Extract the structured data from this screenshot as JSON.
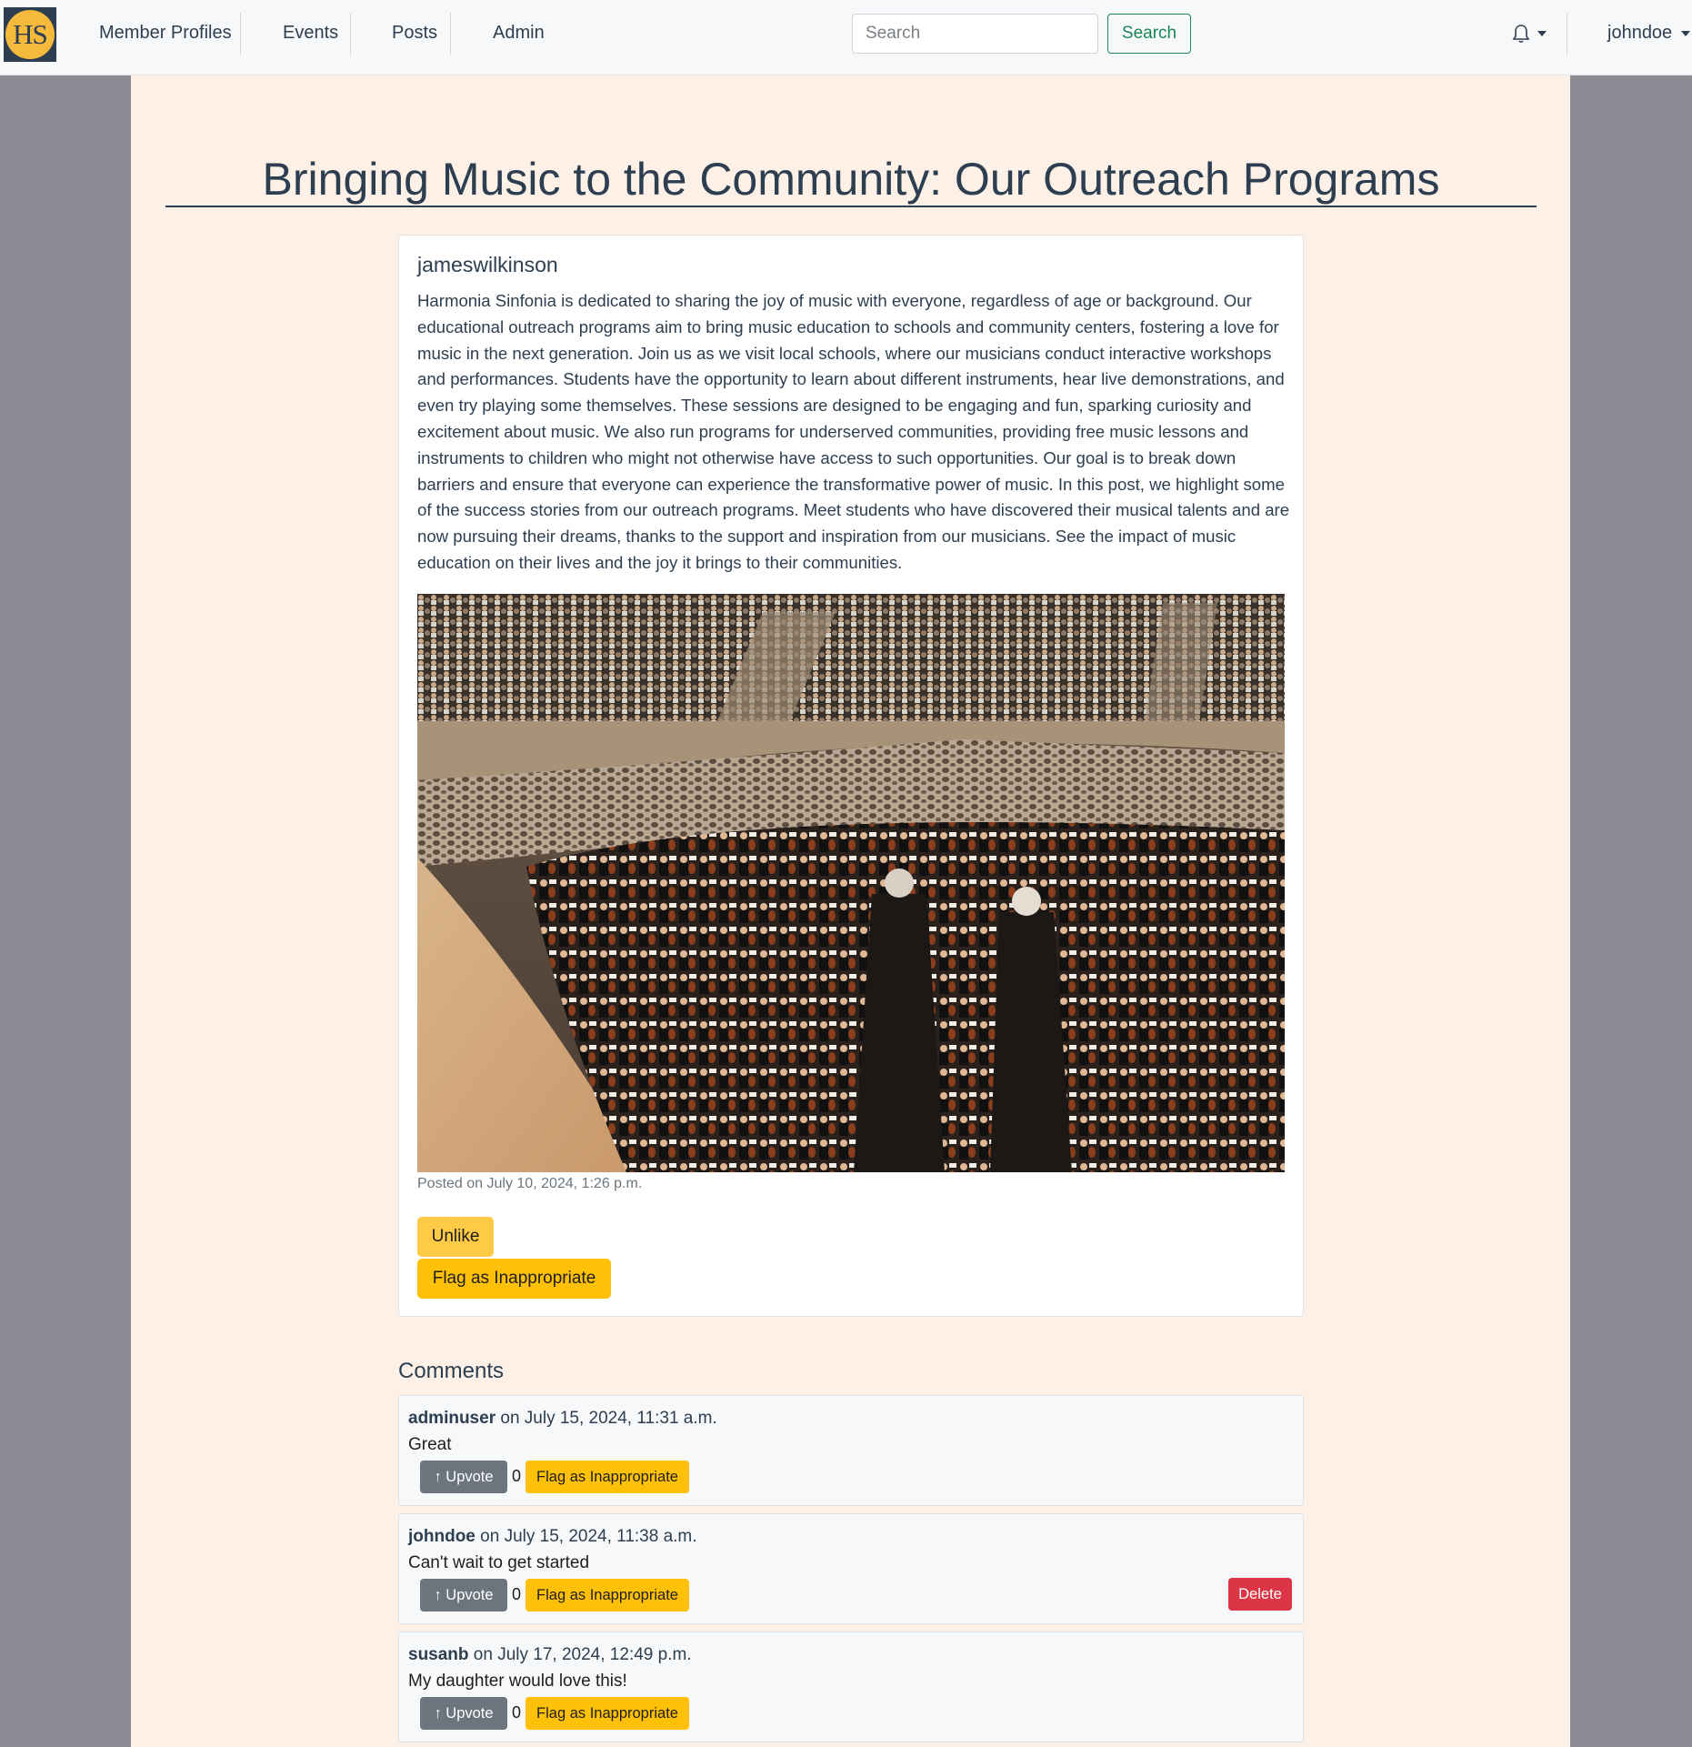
{
  "navbar": {
    "logo_text": "HS",
    "links": [
      "Member Profiles",
      "Events",
      "Posts",
      "Admin"
    ],
    "search_placeholder": "Search",
    "search_button": "Search",
    "username": "johndoe",
    "notifications_icon": "bell-icon"
  },
  "post": {
    "title": "Bringing Music to the Community: Our Outreach Programs",
    "author": "jameswilkinson",
    "body": "Harmonia Sinfonia is dedicated to sharing the joy of music with everyone, regardless of age or background. Our educational outreach programs aim to bring music education to schools and community centers, fostering a love for music in the next generation. Join us as we visit local schools, where our musicians conduct interactive workshops and performances. Students have the opportunity to learn about different instruments, hear live demonstrations, and even try playing some themselves. These sessions are designed to be engaging and fun, sparking curiosity and excitement about music. We also run programs for underserved communities, providing free music lessons and instruments to children who might not otherwise have access to such opportunities. Our goal is to break down barriers and ensure that everyone can experience the transformative power of music. In this post, we highlight some of the success stories from our outreach programs. Meet students who have discovered their musical talents and are now pursuing their dreams, thanks to the support and inspiration from our musicians. See the impact of music education on their lives and the joy it brings to their communities.",
    "posted": "Posted on July 10, 2024, 1:26 p.m.",
    "unlike_label": "Unlike",
    "flag_label": "Flag as Inappropriate"
  },
  "comments": {
    "heading": "Comments",
    "upvote_label": "↑ Upvote",
    "flag_label": "Flag as Inappropriate",
    "delete_label": "Delete",
    "items": [
      {
        "user": "adminuser",
        "date": " on July 15, 2024, 11:31 a.m.",
        "text": "Great",
        "votes": "0"
      },
      {
        "user": "johndoe",
        "date": " on July 15, 2024, 11:38 a.m.",
        "text": "Can't wait to get started",
        "votes": "0"
      },
      {
        "user": "susanb",
        "date": " on July 17, 2024, 12:49 p.m.",
        "text": "My daughter would love this!",
        "votes": "0"
      }
    ]
  }
}
